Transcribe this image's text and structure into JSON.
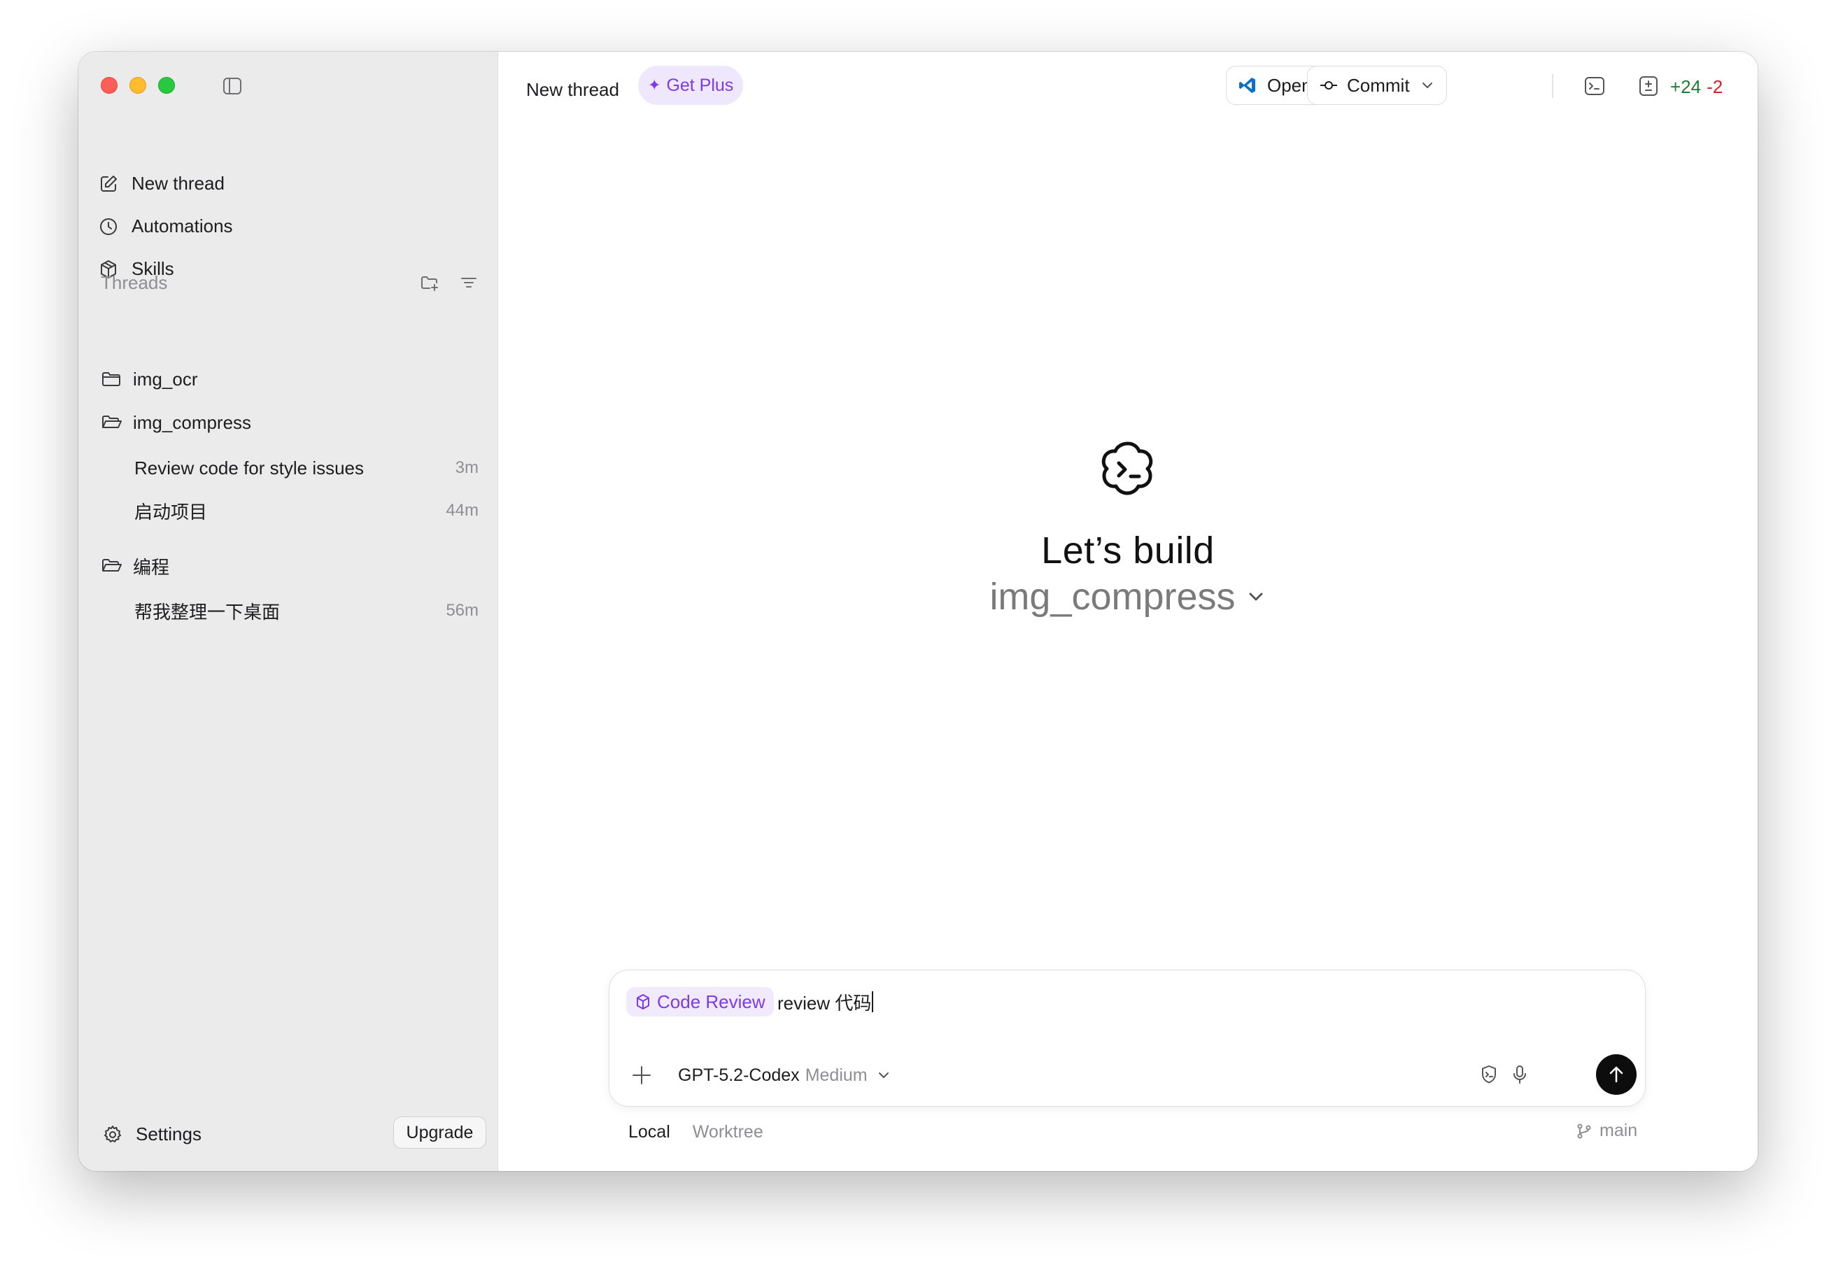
{
  "sidebar": {
    "nav": [
      {
        "label": "New thread",
        "icon": "edit-icon"
      },
      {
        "label": "Automations",
        "icon": "clock-icon"
      },
      {
        "label": "Skills",
        "icon": "cube-icon"
      }
    ],
    "threads_title": "Threads",
    "folders": [
      {
        "name": "img_ocr",
        "threads": []
      },
      {
        "name": "img_compress",
        "threads": [
          {
            "title": "Review code for style issues",
            "time": "3m"
          },
          {
            "title": "启动项目",
            "time": "44m"
          }
        ]
      },
      {
        "name": "编程",
        "threads": [
          {
            "title": "帮我整理一下桌面",
            "time": "56m"
          }
        ]
      }
    ],
    "settings_label": "Settings",
    "upgrade_label": "Upgrade"
  },
  "topbar": {
    "title": "New thread",
    "get_plus_label": "Get Plus",
    "open_label": "Open",
    "commit_label": "Commit",
    "diff_add": "+24",
    "diff_del": "-2"
  },
  "hero": {
    "title": "Let’s build",
    "project": "img_compress"
  },
  "composer": {
    "chip_label": "Code Review",
    "input_text": "review 代码",
    "model": "GPT-5.2-Codex",
    "effort": "Medium"
  },
  "footer": {
    "tab_local": "Local",
    "tab_worktree": "Worktree",
    "branch": "main"
  },
  "colors": {
    "accent": "#7c3aed",
    "sidebar_bg": "#ebebeb",
    "diff_add": "#1a7f37",
    "diff_del": "#cf222e"
  }
}
